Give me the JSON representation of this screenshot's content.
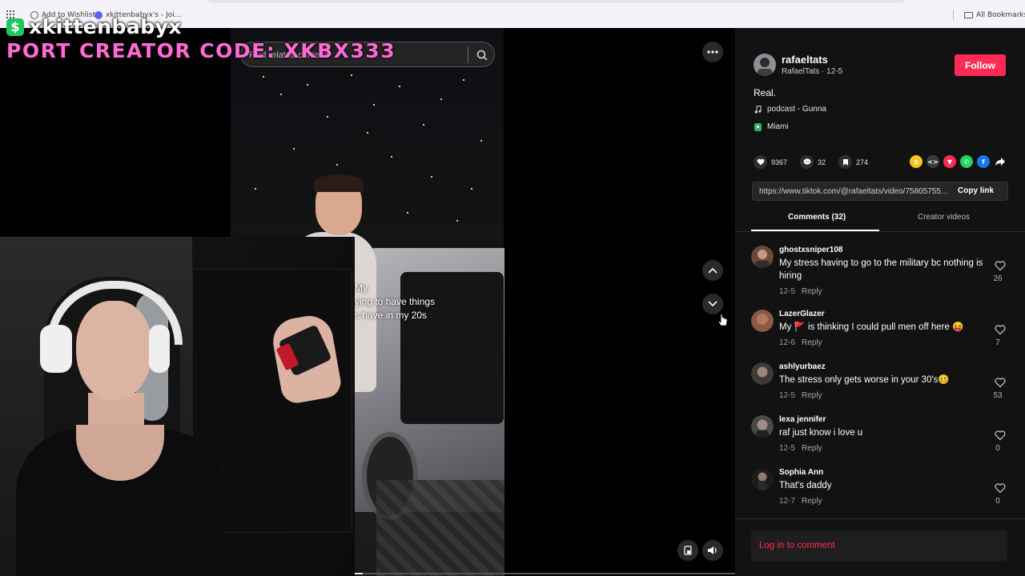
{
  "browser": {
    "bookmarks": [
      {
        "label": "Add to Wishlist"
      },
      {
        "label": "xkittenbabyx's - Joi..."
      }
    ],
    "all_bookmarks_label": "All Bookmarks"
  },
  "overlay": {
    "streamer_name": "xkittenbabyx",
    "creator_code": "PORT CREATOR CODE: XKBX333"
  },
  "video": {
    "search_placeholder": "Find related content",
    "caption_lines": [
      "My",
      "ying to have things",
      "s have in my 20s"
    ],
    "progress": 0.02
  },
  "post": {
    "username": "rafaeltats",
    "subtitle": "RafaelTats · 12-5",
    "follow_label": "Follow",
    "description": "Real.",
    "music": "podcast - Gunna",
    "location": "Miami",
    "likes": "9367",
    "comments_count": "32",
    "saves": "274",
    "link": "https://www.tiktok.com/@rafaeltats/video/7580575562...",
    "copy_link_label": "Copy link",
    "tabs": [
      {
        "label": "Comments (32)",
        "active": true
      },
      {
        "label": "Creator videos",
        "active": false
      }
    ]
  },
  "comments": [
    {
      "user": "ghostxsniper108",
      "text": "My stress having to go to the military bc nothing is hiring",
      "date": "12-5",
      "reply": "Reply",
      "likes": "26"
    },
    {
      "user": "LazerGlazer",
      "text": "My 🚩 is thinking I could pull men off here 😝",
      "date": "12-6",
      "reply": "Reply",
      "likes": "7"
    },
    {
      "user": "ashlyurbaez",
      "text": "The stress only gets worse in your 30's🥴",
      "date": "12-5",
      "reply": "Reply",
      "likes": "53"
    },
    {
      "user": "lexa jennifer",
      "text": "raf just know i love u",
      "date": "12-5",
      "reply": "Reply",
      "likes": "0"
    },
    {
      "user": "Sophia Ann",
      "text": "That's daddy",
      "date": "12-7",
      "reply": "Reply",
      "likes": "0"
    }
  ],
  "login_prompt": "Log in to comment",
  "colors": {
    "accent": "#fe2c55",
    "panel_bg": "#121212",
    "overlay_pink": "#ff6ad5",
    "overlay_green": "#22c55e"
  },
  "icons": {
    "apps": "apps-grid-icon",
    "bookmark_folder": "folder-icon",
    "music": "music-note-icon",
    "location": "location-pin-icon",
    "more": "more-dots-icon",
    "up": "chevron-up-icon",
    "down": "chevron-down-icon",
    "volume": "volume-icon",
    "pip": "picture-in-picture-icon"
  }
}
